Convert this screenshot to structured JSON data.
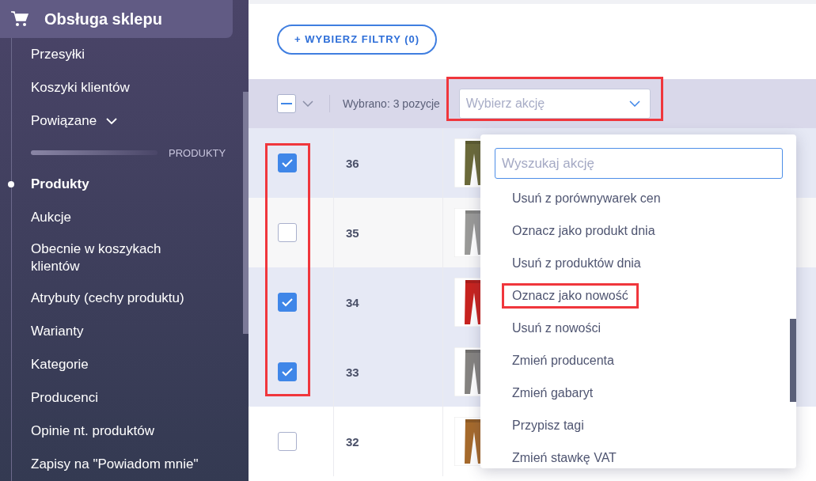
{
  "sidebar": {
    "header": {
      "title": "Obsługa sklepu"
    },
    "items": [
      {
        "kind": "link",
        "label": "Przesyłki",
        "selected": false
      },
      {
        "kind": "link",
        "label": "Koszyki klientów",
        "selected": false
      },
      {
        "kind": "expandable",
        "label": "Powiązane",
        "selected": false,
        "expanded": false
      },
      {
        "kind": "section",
        "label": "PRODUKTY"
      },
      {
        "kind": "link",
        "label": "Produkty",
        "selected": true
      },
      {
        "kind": "link",
        "label": "Aukcje",
        "selected": false
      },
      {
        "kind": "link",
        "label": "Obecnie w koszykach klientów",
        "selected": false
      },
      {
        "kind": "link",
        "label": "Atrybuty (cechy produktu)",
        "selected": false
      },
      {
        "kind": "link",
        "label": "Warianty",
        "selected": false
      },
      {
        "kind": "link",
        "label": "Kategorie",
        "selected": false
      },
      {
        "kind": "link",
        "label": "Producenci",
        "selected": false
      },
      {
        "kind": "link",
        "label": "Opinie nt. produktów",
        "selected": false
      },
      {
        "kind": "link",
        "label": "Zapisy na \"Powiadom mnie\"",
        "selected": false
      }
    ]
  },
  "filters_button": {
    "label": "+ WYBIERZ FILTRY (0)"
  },
  "toolbar": {
    "select_all": {
      "indeterminate": true
    },
    "selection_text": "Wybrano: 3 pozycje",
    "action_select": {
      "placeholder": "Wybierz akcję",
      "highlighted": true
    }
  },
  "table": {
    "checkbox_column_highlighted": true,
    "rows": [
      {
        "id": "36",
        "checked": true
      },
      {
        "id": "35",
        "checked": false
      },
      {
        "id": "34",
        "checked": true
      },
      {
        "id": "33",
        "checked": true
      },
      {
        "id": "32",
        "checked": false
      }
    ]
  },
  "action_menu": {
    "search": {
      "placeholder": "Wyszukaj akcję"
    },
    "items": [
      {
        "label": "Usuń z porównywarek cen",
        "highlighted": false
      },
      {
        "label": "Oznacz jako produkt dnia",
        "highlighted": false
      },
      {
        "label": "Usuń z produktów dnia",
        "highlighted": false
      },
      {
        "label": "Oznacz jako nowość",
        "highlighted": true
      },
      {
        "label": "Usuń z nowości",
        "highlighted": false
      },
      {
        "label": "Zmień producenta",
        "highlighted": false
      },
      {
        "label": "Zmień gabaryt",
        "highlighted": false
      },
      {
        "label": "Przypisz tagi",
        "highlighted": false
      },
      {
        "label": "Zmień stawkę VAT",
        "highlighted": false
      }
    ]
  }
}
